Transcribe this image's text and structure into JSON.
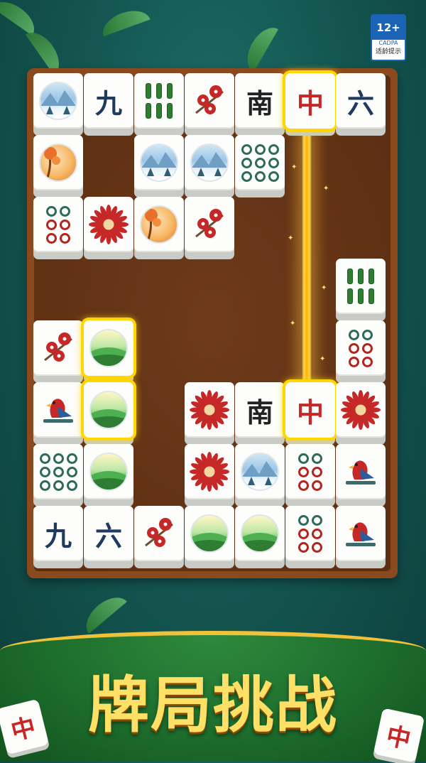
{
  "rating_badge": {
    "age": "12+",
    "org": "CADPA",
    "note": "适龄提示"
  },
  "title": "牌局挑战",
  "corner_tiles": [
    "中",
    "中"
  ],
  "chars": {
    "nine": "九",
    "six": "六",
    "south": "南",
    "red_dragon": "中"
  },
  "tiles": [
    {
      "icon": "winter-scene-icon"
    },
    {
      "icon": "character-nine",
      "text_key": "nine"
    },
    {
      "icon": "bamboo-six-icon"
    },
    {
      "icon": "plum-blossom-icon"
    },
    {
      "icon": "south-wind",
      "text_key": "south"
    },
    {
      "icon": "red-dragon",
      "text_key": "red_dragon",
      "selected": true
    },
    {
      "icon": "character-six",
      "text_key": "six"
    },
    {
      "icon": "autumn-scene-icon"
    },
    {
      "icon": "winter-scene-icon"
    },
    {
      "icon": "winter-scene-icon"
    },
    {
      "icon": "dots-nine-icon"
    },
    {
      "icon": "dots-six-icon"
    },
    {
      "icon": "chrysanthemum-icon"
    },
    {
      "icon": "autumn-scene-icon"
    },
    {
      "icon": "plum-blossom-icon"
    },
    {
      "icon": "bamboo-six-icon"
    },
    {
      "icon": "dots-six-icon"
    },
    {
      "icon": "plum-blossom-icon"
    },
    {
      "icon": "spring-scene-icon",
      "selected": true
    },
    {
      "icon": "bird-icon"
    },
    {
      "icon": "spring-scene-icon",
      "selected": true
    },
    {
      "icon": "chrysanthemum-icon"
    },
    {
      "icon": "south-wind",
      "text_key": "south"
    },
    {
      "icon": "red-dragon",
      "text_key": "red_dragon",
      "selected": true
    },
    {
      "icon": "chrysanthemum-icon"
    },
    {
      "icon": "dots-nine-icon"
    },
    {
      "icon": "spring-scene-icon"
    },
    {
      "icon": "chrysanthemum-icon"
    },
    {
      "icon": "winter-scene-icon"
    },
    {
      "icon": "dots-six-icon"
    },
    {
      "icon": "bird-icon"
    },
    {
      "icon": "character-nine",
      "text_key": "nine"
    },
    {
      "icon": "character-six",
      "text_key": "six"
    },
    {
      "icon": "plum-blossom-icon"
    },
    {
      "icon": "spring-scene-icon"
    },
    {
      "icon": "spring-scene-icon"
    },
    {
      "icon": "dots-six-icon"
    },
    {
      "icon": "bird-icon"
    }
  ]
}
